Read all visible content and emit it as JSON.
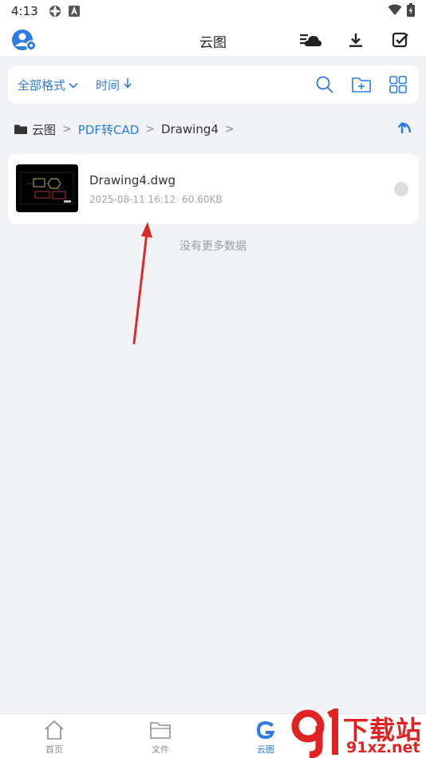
{
  "status_bar": {
    "time": "4:13"
  },
  "header": {
    "title": "云图"
  },
  "filter": {
    "format_label": "全部格式",
    "sort_label": "时间"
  },
  "breadcrumb": {
    "items": [
      "云图",
      "PDF转CAD",
      "Drawing4"
    ]
  },
  "file": {
    "name": "Drawing4.dwg",
    "date": "2025-08-11 16:12",
    "size": "60.60KB"
  },
  "list_footer": "没有更多数据",
  "bottom_nav": {
    "tabs": [
      "首页",
      "文件",
      "云图"
    ],
    "active_index": 2
  },
  "watermark": {
    "text": "下载站",
    "url": "91xz.net"
  },
  "colors": {
    "accent": "#2c7be5",
    "background": "#f1f2f6",
    "annotation": "#d92b2b"
  }
}
